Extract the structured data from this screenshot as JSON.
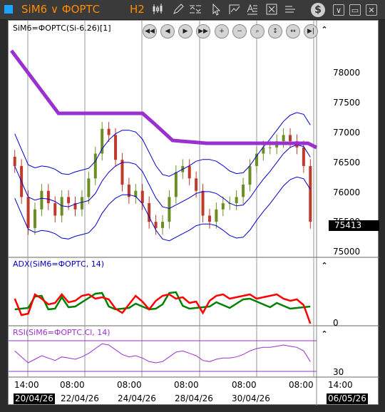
{
  "toolbar": {
    "symbol": "SiM6",
    "instrument": "ФОРТС",
    "timeframe": "H2"
  },
  "panes": {
    "price": {
      "label": "SiM6=ФОРТС(Si-6.26)[1]"
    },
    "adx": {
      "label": "ADX(SiM6=ФОРТС, 14)"
    },
    "rsi": {
      "label": "RSI(SiM6=ФОРТС.Cl, 14)"
    }
  },
  "price_axis": [
    "78000",
    "77500",
    "77000",
    "76500",
    "76000",
    "75500",
    "75000"
  ],
  "last_price": "75413",
  "adx_axis": [
    "0"
  ],
  "rsi_axis": [
    "30"
  ],
  "time_axis": [
    "14:00",
    "08:00",
    "08:00",
    "08:00",
    "08:00",
    "08:00",
    "14:00"
  ],
  "date_labels": [
    "20/04/26",
    "22/04/26",
    "24/04/26",
    "28/04/26",
    "30/04/26",
    "06/05/26"
  ],
  "colors": {
    "accent": "#ff8c00",
    "candle_up": "#6b8e23",
    "candle_down": "#c0392b",
    "bands": "#0000cc",
    "sar": "#9b30d0",
    "adx_plus": "#008000",
    "adx_minus": "#ff0000",
    "rsi": "#9b30d0"
  },
  "chart_data": {
    "type": "line",
    "price_candles_close": [
      76300,
      75800,
      75300,
      75600,
      75900,
      75700,
      75500,
      75800,
      75700,
      75600,
      75800,
      76100,
      76500,
      76900,
      76800,
      76400,
      76000,
      75800,
      75900,
      75700,
      75400,
      75300,
      75400,
      75800,
      76200,
      76300,
      76100,
      75900,
      75500,
      75400,
      75600,
      75700,
      75700,
      75800,
      76000,
      76300,
      76500,
      76600,
      76600,
      76700,
      76800,
      76700,
      76600,
      76300,
      75400
    ]
  }
}
